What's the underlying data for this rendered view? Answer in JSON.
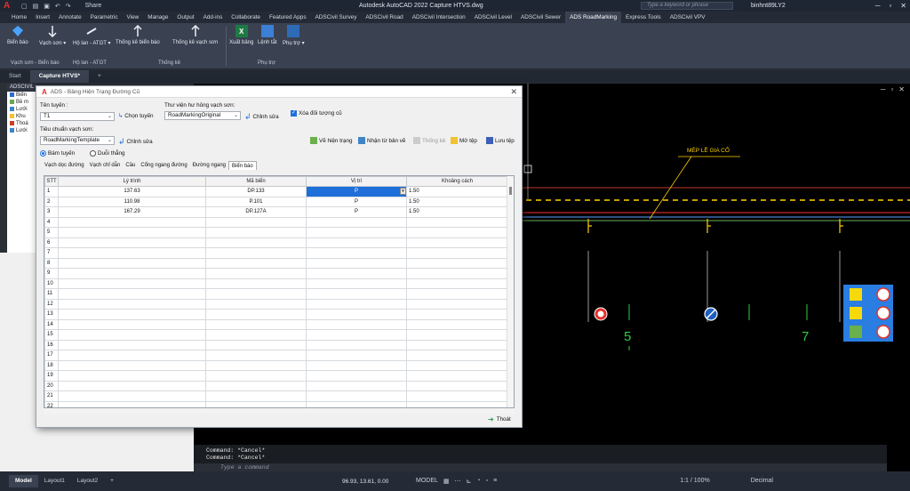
{
  "titlebar": {
    "title": "Autodesk AutoCAD 2022    Capture HTVS.dwg",
    "logo": "A",
    "share": "Share",
    "search_placeholder": "Type a keyword or phrase",
    "user": "binhnt89LY2",
    "quick_access": [
      "▢",
      "▤",
      "▣",
      "↶",
      "↷"
    ]
  },
  "menu_tabs": [
    "Home",
    "Insert",
    "Annotate",
    "Parametric",
    "View",
    "Manage",
    "Output",
    "Add-ins",
    "Collaborate",
    "Featured Apps",
    "ADSCivil Survey",
    "ADSCivil Road",
    "ADSCivil Intersection",
    "ADSCivil Level",
    "ADSCivil Sewer",
    "ADS RoadMarking",
    "Express Tools",
    "ADSCivil VPV"
  ],
  "active_menu_tab": "ADS RoadMarking",
  "ribbon": {
    "buttons": [
      {
        "label": "Biển báo",
        "icon": "sign-icon"
      },
      {
        "label": "Vạch sơn ▾",
        "icon": "paint-line-icon"
      },
      {
        "label": "Hộ lan - ATGT ▾",
        "icon": "guardrail-icon"
      },
      {
        "label": "Thống kê biển báo",
        "icon": "sign-stats-icon"
      },
      {
        "label": "Thống kê vạch sơn",
        "icon": "line-stats-icon"
      },
      {
        "label": "Xuất bảng",
        "icon": "excel-icon"
      },
      {
        "label": "Lệnh tắt",
        "icon": "shortcut-icon"
      },
      {
        "label": "Phụ trợ ▾",
        "icon": "helper-icon"
      }
    ],
    "groups": [
      "Vạch sơn - Biển báo",
      "Hộ lan - ATGT",
      "Thống kê",
      "Phụ trợ"
    ]
  },
  "doc_tabs": [
    "Start",
    "Capture HTVS*",
    "+"
  ],
  "active_doc_tab": "Capture HTVS*",
  "palette": {
    "title": "ADSCIVIL",
    "items": [
      "Biển",
      "Bề m",
      "Lưới",
      "Khu",
      "Thoá",
      "Lưới"
    ]
  },
  "drawing": {
    "label_text": "MÉP LỀ GIA CỐ",
    "numbers": [
      "5",
      "7"
    ],
    "view_controls": [
      "─",
      "▫",
      "✕"
    ]
  },
  "command": {
    "history": [
      "Command: *Cancel*",
      "Command: *Cancel*"
    ],
    "placeholder": "Type a command"
  },
  "status": {
    "layout_tabs": [
      "Model",
      "Layout1",
      "Layout2",
      "+"
    ],
    "coords": "96.93, 13.61, 0.00",
    "model_label": "MODEL",
    "scale": "1:1 / 100%",
    "units": "Decimal"
  },
  "dialog": {
    "title": "ADS - Bảng Hiện Trạng Đường Cũ",
    "route_label": "Tên tuyến :",
    "route_value": "T1",
    "choose_route": "Chọn tuyến",
    "lib_label": "Thư viện hư hỏng vạch sơn:",
    "lib_value": "RoadMarkingOriginal",
    "edit1": "Chỉnh sửa",
    "delete_old": "Xóa đối tượng cũ",
    "std_label": "Tiêu chuẩn vạch sơn:",
    "std_value": "RoadMarkingTemplate",
    "edit2": "Chỉnh sửa",
    "toolbar": [
      "Vẽ hiện trạng",
      "Nhận từ bản vẽ",
      "Thống kê",
      "Mở tệp",
      "Lưu tệp"
    ],
    "radios": [
      "Bám tuyến",
      "Duỗi thẳng"
    ],
    "tabs": [
      "Vạch dọc đường",
      "Vạch chỉ dẫn",
      "Cầu",
      "Cổng ngang đường",
      "Đường ngang",
      "Biển báo"
    ],
    "active_tab": "Biển báo",
    "columns": [
      "STT",
      "Lý trình",
      "Mã biển",
      "Vị trí",
      "Khoảng cách"
    ],
    "rows": [
      [
        "1",
        "137.63",
        "DP.133",
        "P",
        "1.50"
      ],
      [
        "2",
        "110.98",
        "P.101",
        "P",
        "1.50"
      ],
      [
        "3",
        "167.29",
        "DP.127A",
        "P",
        "1.50"
      ],
      [
        "4",
        "",
        "",
        "",
        ""
      ],
      [
        "5",
        "",
        "",
        "",
        ""
      ],
      [
        "6",
        "",
        "",
        "",
        ""
      ],
      [
        "7",
        "",
        "",
        "",
        ""
      ],
      [
        "8",
        "",
        "",
        "",
        ""
      ],
      [
        "9",
        "",
        "",
        "",
        ""
      ],
      [
        "10",
        "",
        "",
        "",
        ""
      ],
      [
        "11",
        "",
        "",
        "",
        ""
      ],
      [
        "12",
        "",
        "",
        "",
        ""
      ],
      [
        "13",
        "",
        "",
        "",
        ""
      ],
      [
        "14",
        "",
        "",
        "",
        ""
      ],
      [
        "15",
        "",
        "",
        "",
        ""
      ],
      [
        "16",
        "",
        "",
        "",
        ""
      ],
      [
        "17",
        "",
        "",
        "",
        ""
      ],
      [
        "18",
        "",
        "",
        "",
        ""
      ],
      [
        "19",
        "",
        "",
        "",
        ""
      ],
      [
        "20",
        "",
        "",
        "",
        ""
      ],
      [
        "21",
        "",
        "",
        "",
        ""
      ],
      [
        "22",
        "",
        "",
        "",
        ""
      ]
    ],
    "exit": "Thoát"
  },
  "colors": {
    "accent_red": "#e3322b",
    "selection_blue": "#1e6fd9",
    "line_yellow": "#ffd200",
    "canvas": "#000000"
  }
}
